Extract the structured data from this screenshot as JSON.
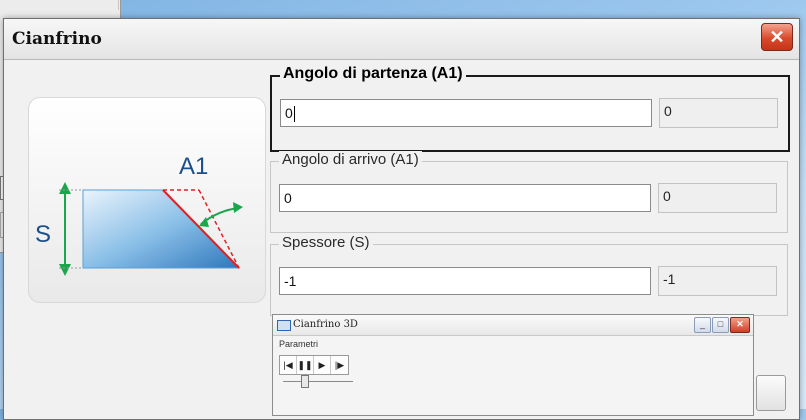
{
  "dialog": {
    "title": "Cianfrino",
    "close_label": "✕"
  },
  "illustration": {
    "label_angle": "A1",
    "label_thickness": "S"
  },
  "fields": [
    {
      "legend": "Angolo di partenza (A1)",
      "value": "0",
      "readout": "0",
      "active": true
    },
    {
      "legend": "Angolo di arrivo (A1)",
      "value": "0",
      "readout": "0",
      "active": false
    },
    {
      "legend": "Spessore (S)",
      "value": "-1",
      "readout": "-1",
      "active": false
    }
  ],
  "preview": {
    "title": "Cianfrino 3D",
    "minimize_label": "_",
    "maximize_label": "□",
    "close_label": "✕",
    "menu_label": "Parametri",
    "controls": [
      "|◀",
      "❚❚",
      "▶",
      "|▶"
    ]
  },
  "colors": {
    "close_button": "#d94a2c",
    "arrow_green": "#1aa64b",
    "cut_red": "#e02020",
    "block_blue": "#5a9fd6"
  }
}
